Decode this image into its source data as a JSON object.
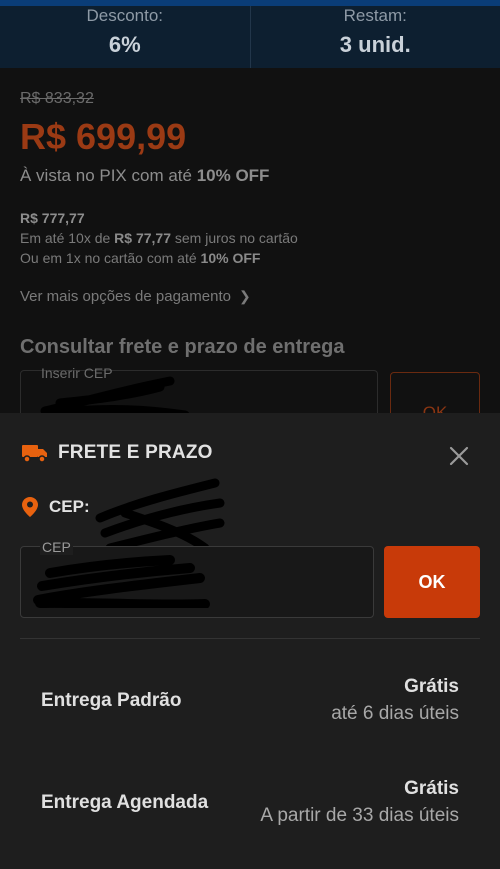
{
  "stats": [
    {
      "label": "Desconto:",
      "value": "6%"
    },
    {
      "label": "Restam:",
      "value": "3 unid."
    }
  ],
  "pricing": {
    "old_price": "R$ 833,32",
    "price": "R$ 699,99",
    "pix_prefix": "À vista no PIX com até ",
    "pix_discount": "10% OFF",
    "card_price": "R$ 777,77",
    "installments_prefix": "Em até 10x de ",
    "installments_value": "R$ 77,77",
    "installments_suffix": " sem juros no cartão",
    "single_prefix": "Ou em 1x no cartão com até ",
    "single_discount": "10% OFF",
    "more_payment": "Ver mais opções de pagamento"
  },
  "shipping_section": {
    "title": "Consultar frete e prazo de entrega",
    "input_label": "Inserir CEP",
    "ok_label": "OK"
  },
  "sheet": {
    "title": "FRETE E PRAZO",
    "cep_label": "CEP: ",
    "input_label": "CEP",
    "ok_label": "OK",
    "options": [
      {
        "name": "Entrega Padrão",
        "price": "Grátis",
        "time": "até 6 dias úteis"
      },
      {
        "name": "Entrega Agendada",
        "price": "Grátis",
        "time": "A partir de 33 dias úteis"
      }
    ]
  },
  "colors": {
    "accent": "#c83a09",
    "icon_orange": "#e8620f",
    "sheet_bg": "#1e1e1e"
  },
  "icons": {
    "truck": "truck-icon",
    "close": "close-icon",
    "pin": "location-pin-icon",
    "chevron": "chevron-right-icon"
  }
}
